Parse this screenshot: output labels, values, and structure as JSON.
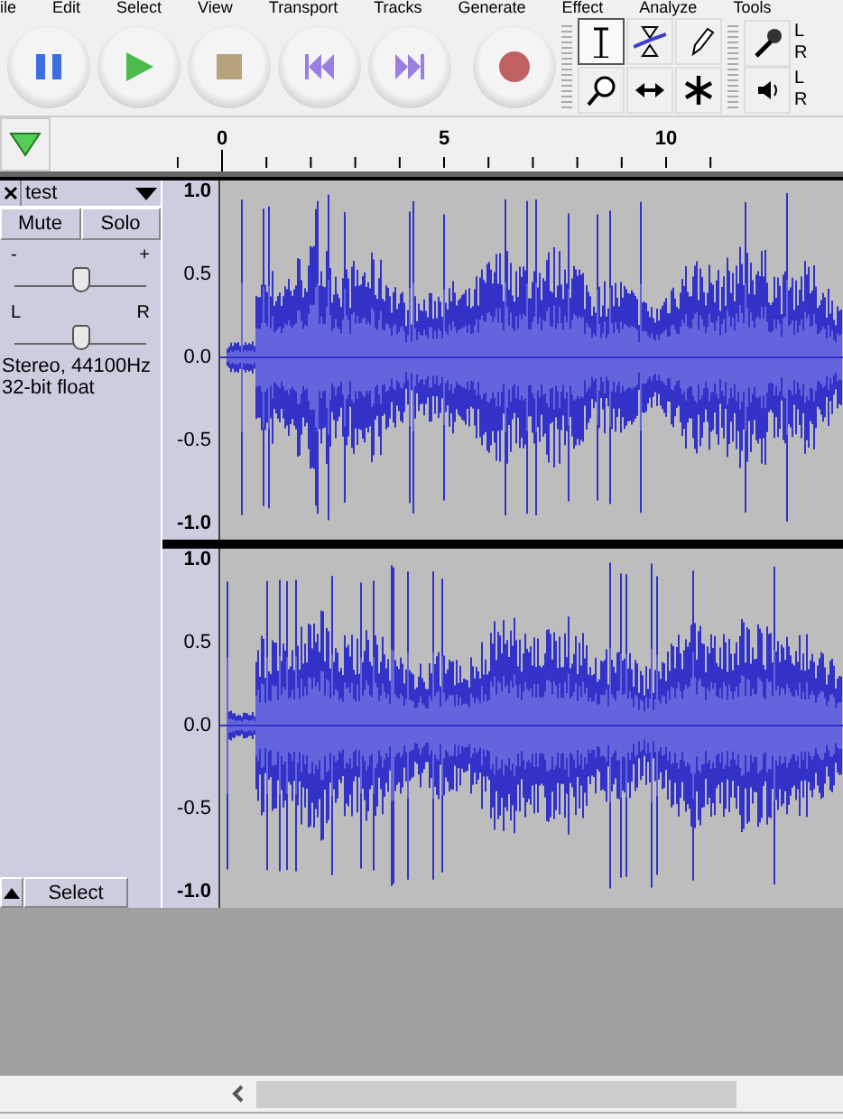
{
  "menu": [
    "ile",
    "Edit",
    "Select",
    "View",
    "Transport",
    "Tracks",
    "Generate",
    "Effect",
    "Analyze",
    "Tools"
  ],
  "transport": [
    {
      "kind": "pause"
    },
    {
      "kind": "play"
    },
    {
      "kind": "stop"
    },
    {
      "kind": "skip-start"
    },
    {
      "kind": "skip-end"
    },
    {
      "kind": "record"
    }
  ],
  "tools": [
    {
      "kind": "select",
      "selected": true
    },
    {
      "kind": "envelope",
      "selected": false
    },
    {
      "kind": "draw",
      "selected": false
    },
    {
      "kind": "zoom",
      "selected": false
    },
    {
      "kind": "timeshift",
      "selected": false
    },
    {
      "kind": "multi",
      "selected": false
    }
  ],
  "meters": [
    {
      "kind": "record",
      "left": "L",
      "right": "R"
    },
    {
      "kind": "play",
      "left": "L",
      "right": "R"
    }
  ],
  "ruler": {
    "labels": [
      "0",
      "5",
      "10"
    ]
  },
  "track": {
    "name": "test",
    "mute": "Mute",
    "solo": "Solo",
    "gain": {
      "minus": "-",
      "plus": "+",
      "level": 0.5
    },
    "pan": {
      "left": "L",
      "right": "R",
      "level": 0.5
    },
    "info": [
      "Stereo, 44100Hz",
      "32-bit float"
    ],
    "select": "Select",
    "channels": [
      {
        "scale": [
          "1.0",
          "0.5",
          "0.0",
          "-0.5",
          "-1.0"
        ]
      },
      {
        "scale": [
          "1.0",
          "0.5",
          "0.0",
          "-0.5",
          "-1.0"
        ]
      }
    ]
  }
}
